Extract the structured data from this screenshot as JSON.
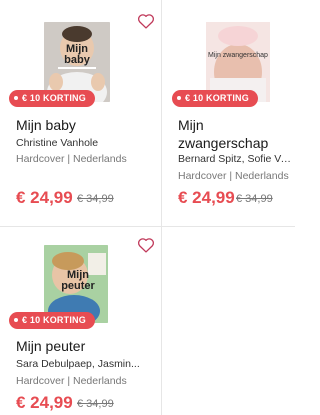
{
  "accent_color": "#e74c52",
  "products": [
    {
      "cover_title": "Mijn baby",
      "cover_title_line1": "Mijn",
      "cover_title_line2": "baby",
      "badge": "€ 10 KORTING",
      "title": "Mijn baby",
      "author": "Christine Vanhole",
      "format": "Hardcover | Nederlands",
      "price": "€ 24,99",
      "old_price": "€ 34,99",
      "heart_icon": "heart-outline-icon"
    },
    {
      "cover_title": "Mijn zwangerschap",
      "badge": "€ 10 KORTING",
      "title_line1": "Mijn",
      "title_line2": "zwangerschap",
      "author": "Bernard Spitz, Sofie Van...",
      "format": "Hardcover | Nederlands",
      "price": "€ 24,99",
      "old_price": "€ 34,99"
    },
    {
      "cover_title_line1": "Mijn",
      "cover_title_line2": "peuter",
      "badge": "€ 10 KORTING",
      "title": "Mijn peuter",
      "author": "Sara Debulpaep, Jasmin...",
      "format": "Hardcover | Nederlands",
      "price": "€ 24,99",
      "old_price": "€ 34,99",
      "heart_icon": "heart-outline-icon"
    }
  ]
}
